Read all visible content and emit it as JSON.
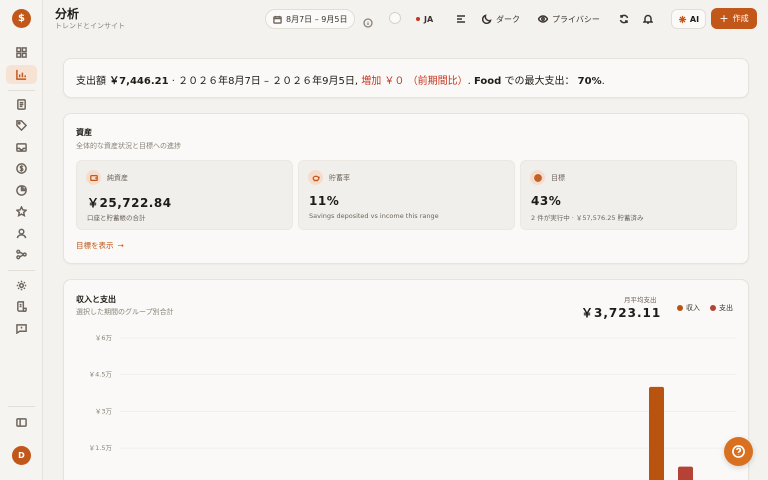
{
  "sidebar": {
    "logo_symbol": "$",
    "items": [
      {
        "name": "dashboard-icon"
      },
      {
        "name": "analytics-icon",
        "active": true
      },
      {
        "name": "document-icon"
      },
      {
        "name": "tag-icon"
      },
      {
        "name": "inbox-icon"
      },
      {
        "name": "dollar-icon"
      },
      {
        "name": "pie-icon"
      },
      {
        "name": "star-icon"
      },
      {
        "name": "user-icon"
      },
      {
        "name": "share-icon"
      },
      {
        "name": "settings-icon"
      },
      {
        "name": "receipt-icon"
      },
      {
        "name": "message-icon"
      },
      {
        "name": "collapse-icon"
      }
    ],
    "avatar_initial": "D"
  },
  "header": {
    "title": "分析",
    "subtitle": "トレンドとインサイト",
    "date_range": "8月7日 – 9月5日",
    "language": "JA",
    "theme_label": "ダーク",
    "privacy_label": "プライバシー",
    "ai_label": "AI",
    "create_label": "作成"
  },
  "summary": {
    "prefix": "支出額 ",
    "amount": "￥7,446.21",
    "middle": " · ２０２６年8月7日 – ２０２６年9月5日, ",
    "increase": "増加 ￥０ （前期間比）",
    "after_increase": ". ",
    "category": "Food",
    "category_suffix": " での最大支出： ",
    "percent": "70%",
    "end": "."
  },
  "assets": {
    "title": "資産",
    "subtitle": "全体的な資産状況と目標への進捗",
    "metrics": [
      {
        "label": "純資産",
        "value": "￥25,722.84",
        "note": "口座と貯蓄帳の合計",
        "icon": "wallet-icon"
      },
      {
        "label": "貯蓄率",
        "value": "11%",
        "note": "Savings deposited vs income this range",
        "icon": "piggy-bank-icon"
      },
      {
        "label": "目標",
        "value": "43%",
        "note": "2 件が実行中 · ￥57,576.25 貯蓄済み",
        "icon": "target-icon"
      }
    ],
    "goals_link": "目標を表示"
  },
  "income_expense": {
    "title": "収入と支出",
    "subtitle": "選択した期間のグループ別合計",
    "avg_label": "月平均支出",
    "avg_value": "￥3,723.11",
    "legend": [
      {
        "label": "収入",
        "color": "#b8540f"
      },
      {
        "label": "支出",
        "color": "#b54235"
      }
    ]
  },
  "chart_data": {
    "type": "bar",
    "y_ticks": [
      "￥6万",
      "￥4.5万",
      "￥3万",
      "￥1.5万"
    ],
    "ylim": [
      0,
      60000
    ],
    "series": [
      {
        "name": "収入",
        "color": "#b8540f",
        "values": [
          40000
        ]
      },
      {
        "name": "支出",
        "color": "#b54235",
        "values": [
          7446.21
        ]
      }
    ]
  }
}
